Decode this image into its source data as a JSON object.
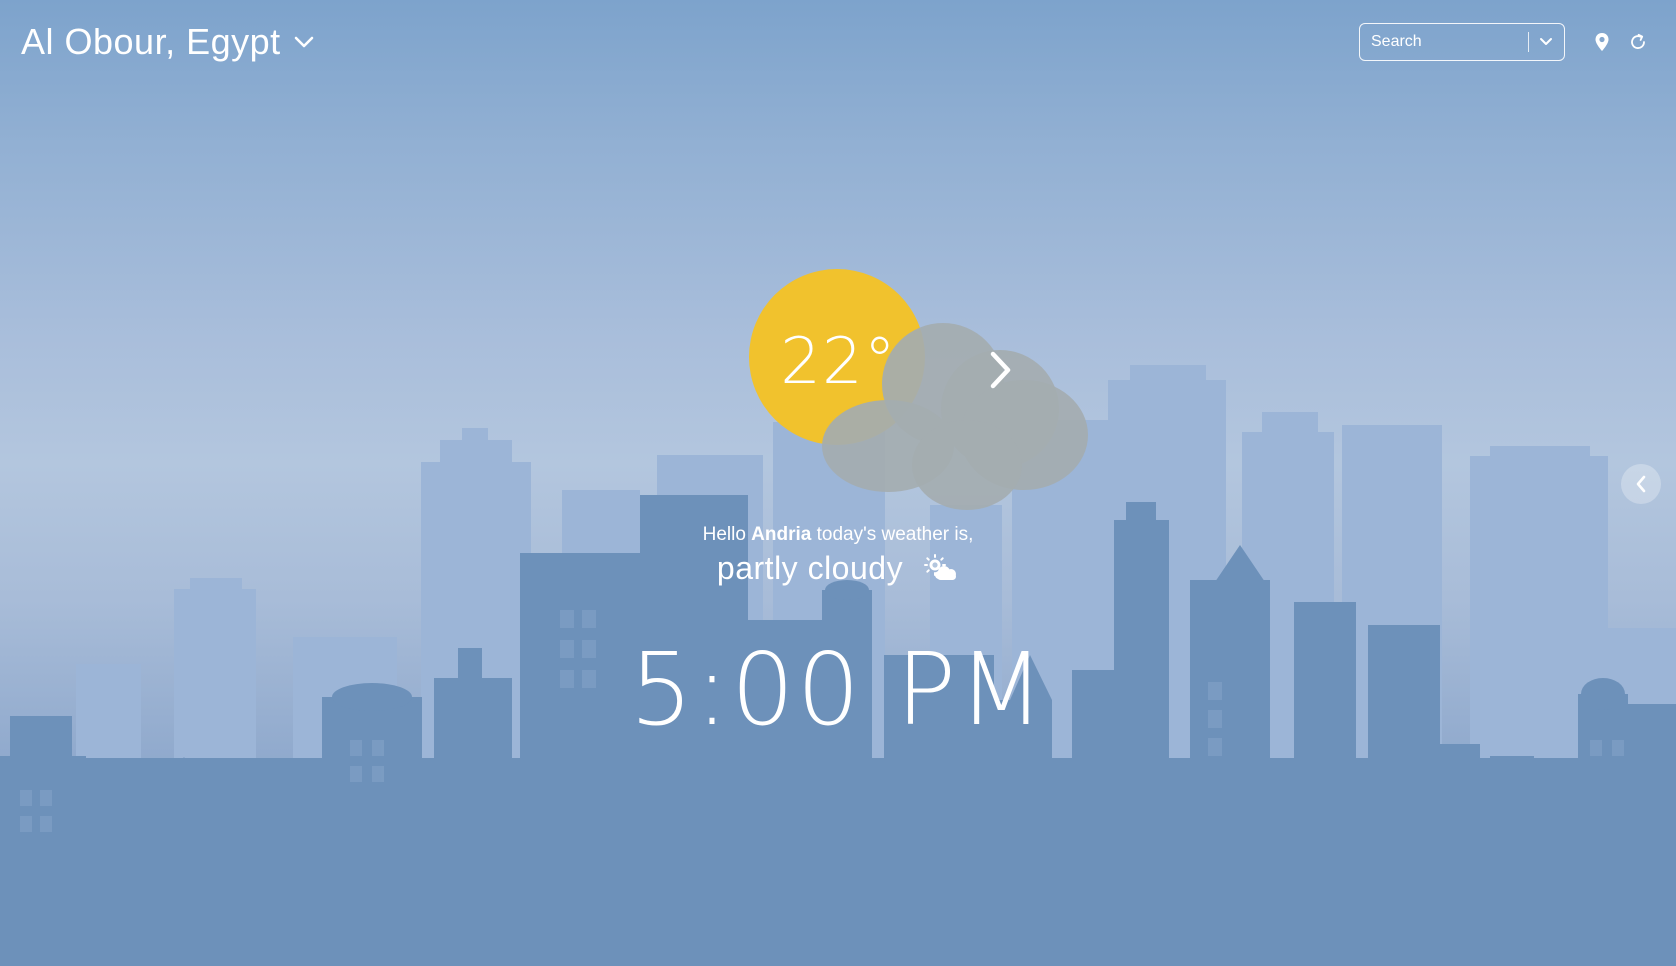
{
  "header": {
    "location": "Al Obour, Egypt",
    "location_dropdown_icon": "chevron-down-icon"
  },
  "search": {
    "placeholder": "Search",
    "value": "",
    "dropdown_icon": "chevron-down-icon"
  },
  "toolbar": {
    "locate_icon": "map-pin-icon",
    "refresh_icon": "refresh-icon"
  },
  "weather": {
    "temperature": "22°",
    "greeting_prefix": "Hello ",
    "user_name": "Andria",
    "greeting_suffix": " today's weather is,",
    "condition": "partly cloudy",
    "condition_icon": "sun-cloud-icon",
    "graphic": "sun-behind-cloud",
    "next_icon": "chevron-right-icon"
  },
  "clock": {
    "time": "5:00 PM"
  },
  "side_panel": {
    "toggle_icon": "chevron-left-icon"
  },
  "colors": {
    "sun": "#f1c22d",
    "cloud": "#a4acb0",
    "sky_top": "#7da3cc",
    "sky_mid": "#b3c6de",
    "buildings_back": "#9cb5d7",
    "buildings_front": "#6b8fb8",
    "text": "#ffffff"
  }
}
